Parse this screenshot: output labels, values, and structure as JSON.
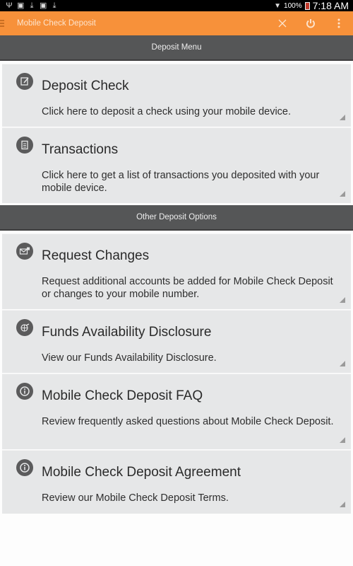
{
  "status_bar": {
    "left_icons": [
      "usb-icon",
      "notification-icon",
      "download-icon",
      "image-icon",
      "download-icon"
    ],
    "battery_percent": "100%",
    "time": "7:18 AM"
  },
  "app_bar": {
    "title": "Mobile Check Deposit",
    "actions": [
      "close-icon",
      "power-icon",
      "overflow-menu-icon"
    ],
    "accent_color": "#f7913a"
  },
  "sections": [
    {
      "header": "Deposit Menu",
      "items": [
        {
          "icon": "edit-check-icon",
          "title": "Deposit Check",
          "description": "Click here to deposit a check using your mobile device."
        },
        {
          "icon": "document-icon",
          "title": "Transactions",
          "description": "Click here to get a list of transactions you deposited with your mobile device."
        }
      ]
    },
    {
      "header": "Other Deposit Options",
      "items": [
        {
          "icon": "mail-lock-icon",
          "title": "Request Changes",
          "description": "Request additional accounts be added for Mobile Check Deposit or changes to your mobile number."
        },
        {
          "icon": "globe-icon",
          "title": "Funds Availability Disclosure",
          "description": "View our Funds Availability Disclosure."
        },
        {
          "icon": "info-icon",
          "title": "Mobile Check Deposit FAQ",
          "description": "Review frequently asked questions about Mobile Check Deposit."
        },
        {
          "icon": "info-icon",
          "title": "Mobile Check Deposit Agreement",
          "description": "Review our Mobile Check Deposit Terms."
        }
      ]
    }
  ]
}
